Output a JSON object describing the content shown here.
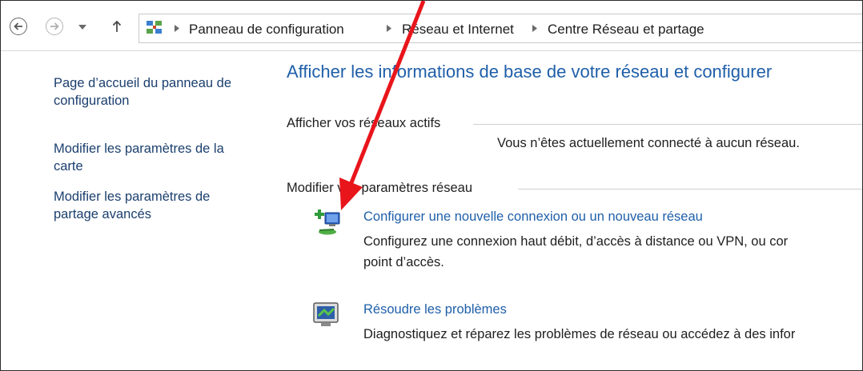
{
  "addressbar": {
    "breadcrumbs": [
      {
        "label": "Panneau de configuration"
      },
      {
        "label": "Réseau et Internet"
      },
      {
        "label": "Centre Réseau et partage"
      }
    ]
  },
  "sidebar": {
    "links": [
      {
        "label_line1": "Page d’accueil du panneau de",
        "label_line2": "configuration"
      },
      {
        "label_line1": "Modifier les paramètres de la",
        "label_line2": "carte"
      },
      {
        "label_line1": "Modifier les paramètres de",
        "label_line2": "partage avancés"
      }
    ]
  },
  "main": {
    "title": "Afficher les informations de base de votre réseau et configurer",
    "active_networks": {
      "heading": "Afficher vos réseaux actifs",
      "status": "Vous n’êtes actuellement connecté à aucun réseau."
    },
    "change_settings": {
      "heading": "Modifier vos paramètres réseau",
      "tasks": [
        {
          "icon": "new-connection-icon",
          "link": "Configurer une nouvelle connexion ou un nouveau réseau",
          "desc_line1": "Configurez une connexion haut débit, d’accès à distance ou VPN, ou cor",
          "desc_line2": "point d’accès."
        },
        {
          "icon": "troubleshoot-icon",
          "link": "Résoudre les problèmes",
          "desc_line1": "Diagnostiquez et réparez les problèmes de réseau ou accédez à des infor"
        }
      ]
    }
  },
  "colors": {
    "link": "#1f5fa9",
    "sidebar_link": "#1b3f6e",
    "annotation_arrow": "#e8151b"
  }
}
